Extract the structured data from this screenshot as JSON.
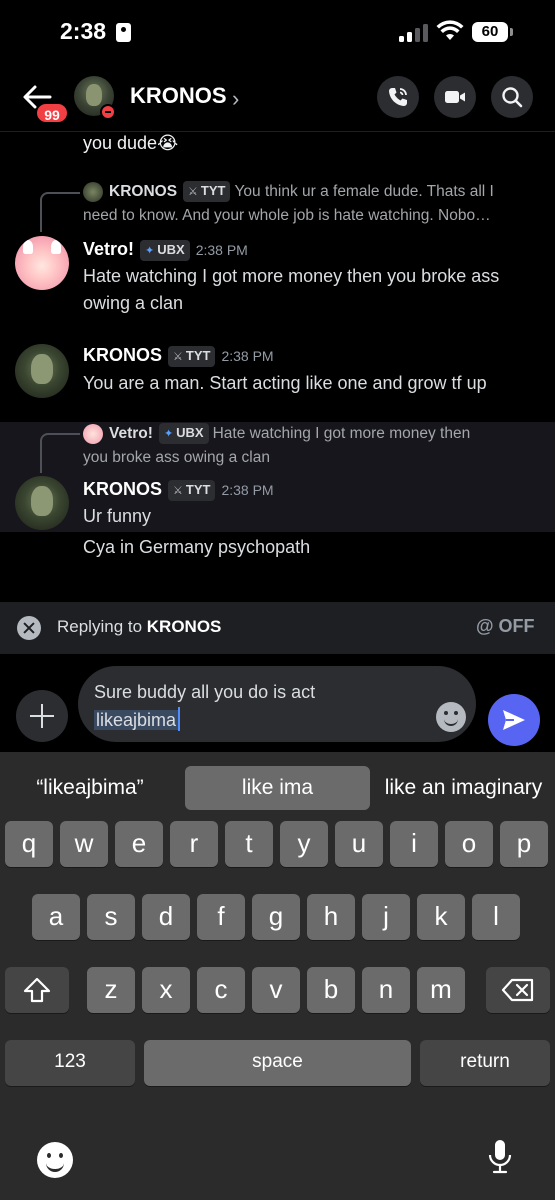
{
  "status_bar": {
    "time": "2:38",
    "battery": "60"
  },
  "header": {
    "unread_count": "99",
    "channel_name": "KRONOS",
    "chevron": "›"
  },
  "messages": {
    "top_fragment": "you dude😭",
    "reply1": {
      "author": "KRONOS",
      "tag": "TYT",
      "preview_line1": "You think ur a female dude. Thats all I",
      "preview_line2": "need to know. And your whole job is hate watching. Nobo…"
    },
    "msg1": {
      "author": "Vetro!",
      "tag": "UBX",
      "time": "2:38 PM",
      "line1": "Hate watching I got more money then you broke ass",
      "line2": "owing a clan"
    },
    "msg2": {
      "author": "KRONOS",
      "tag": "TYT",
      "time": "2:38 PM",
      "line1": "You are a man. Start acting like one and grow tf up"
    },
    "reply2": {
      "author": "Vetro!",
      "tag": "UBX",
      "preview_line1": "Hate watching I got more money then",
      "preview_line2": "you broke ass owing a clan"
    },
    "msg3": {
      "author": "KRONOS",
      "tag": "TYT",
      "time": "2:38 PM",
      "line1": "Ur funny",
      "line2": "Cya in Germany psychopath"
    }
  },
  "reply_bar": {
    "prefix": "Replying to ",
    "target": "KRONOS",
    "mention_state": "@ OFF"
  },
  "composer": {
    "line1": "Sure buddy all you do is act",
    "selected_word": "likeajbima"
  },
  "keyboard": {
    "suggestions": [
      "“likeajbima”",
      "like ima",
      "like an imaginary"
    ],
    "row1": [
      "q",
      "w",
      "e",
      "r",
      "t",
      "y",
      "u",
      "i",
      "o",
      "p"
    ],
    "row2": [
      "a",
      "s",
      "d",
      "f",
      "g",
      "h",
      "j",
      "k",
      "l"
    ],
    "row3": [
      "z",
      "x",
      "c",
      "v",
      "b",
      "n",
      "m"
    ],
    "numbers_key": "123",
    "space_key": "space",
    "return_key": "return"
  },
  "colors": {
    "accent": "#5865f2",
    "badge": "#f23f43",
    "background": "#000000",
    "keyboard": "#2b2b2b"
  },
  "icons": [
    "back-arrow-icon",
    "phone-icon",
    "video-icon",
    "search-icon",
    "close-icon",
    "plus-icon",
    "emoji-icon",
    "send-icon",
    "shift-icon",
    "backspace-icon",
    "microphone-icon"
  ]
}
